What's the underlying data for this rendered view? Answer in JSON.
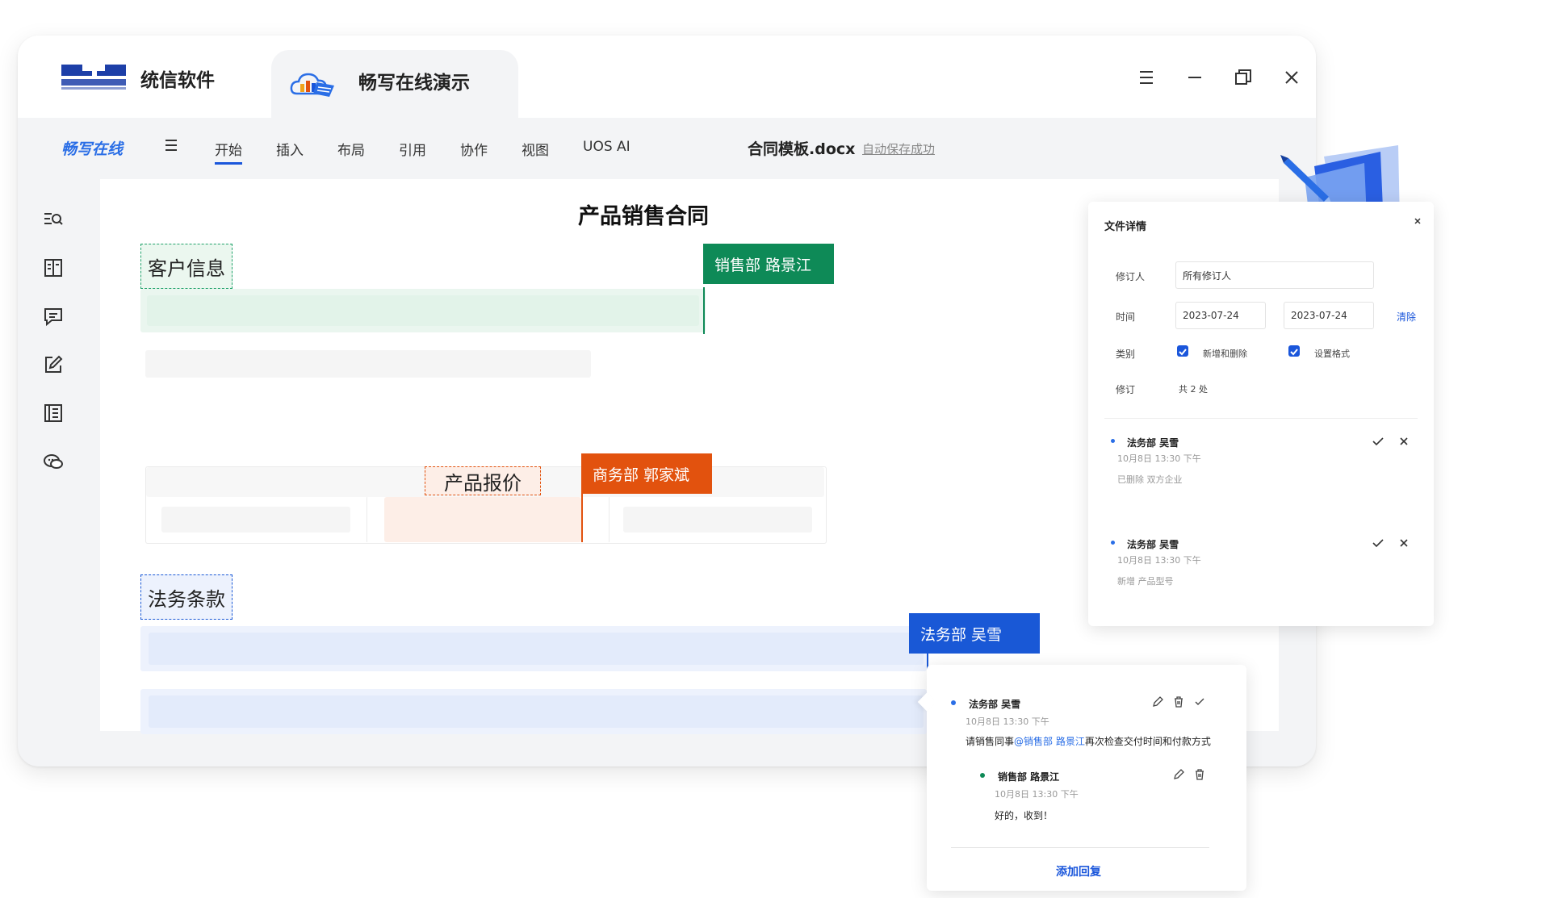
{
  "window": {
    "company_name": "统信软件",
    "app_title": "畅写在线演示"
  },
  "ribbon": {
    "brand": "畅写在线",
    "menus": [
      "开始",
      "插入",
      "布局",
      "引用",
      "协作",
      "视图",
      "UOS AI"
    ],
    "active_menu": "开始",
    "doc_name": "合同模板.docx",
    "save_status": "自动保存成功"
  },
  "document": {
    "title": "产品销售合同",
    "sections": {
      "customer": "客户信息",
      "pricing": "产品报价",
      "legal": "法务条款"
    },
    "tags": {
      "sales": "销售部 路景江",
      "business": "商务部 郭家斌",
      "legal": "法务部 吴雪"
    }
  },
  "details_panel": {
    "title": "文件详情",
    "reviser_label": "修订人",
    "reviser_value": "所有修订人",
    "time_label": "时间",
    "date_from": "2023-07-24",
    "date_to": "2023-07-24",
    "clear_label": "清除",
    "category_label": "类别",
    "category_options": [
      "新增和删除",
      "设置格式"
    ],
    "revision_label": "修订",
    "revision_count": "共 2 处",
    "revisions": [
      {
        "name": "法务部 吴雪",
        "time": "10月8日 13:30 下午",
        "desc": "已删除 双方企业"
      },
      {
        "name": "法务部 吴雪",
        "time": "10月8日 13:30 下午",
        "desc": "新增 产品型号"
      }
    ]
  },
  "comment_card": {
    "author": "法务部 吴雪",
    "time": "10月8日 13:30 下午",
    "text_prefix": "请销售同事",
    "mention": "@销售部 路景江",
    "text_suffix": "再次检查交付时间和付款方式",
    "reply": {
      "author": "销售部 路景江",
      "time": "10月8日 13:30 下午",
      "text": "好的，收到！"
    },
    "add_reply_label": "添加回复"
  },
  "colors": {
    "accent_blue": "#1a56db",
    "sales_green": "#0e8a57",
    "business_orange": "#e2520e",
    "legal_blue": "#1958d6"
  }
}
